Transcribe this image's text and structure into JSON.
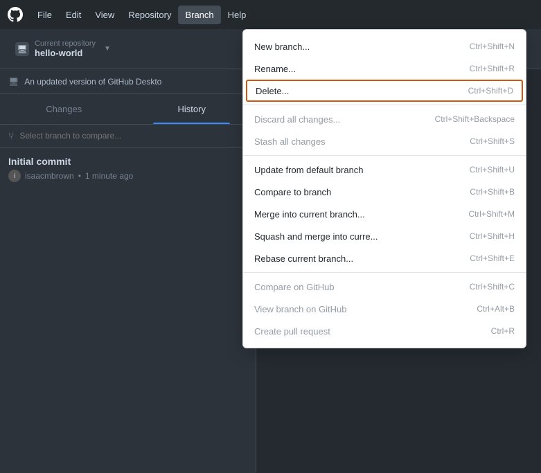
{
  "menubar": {
    "items": [
      {
        "label": "File",
        "active": false
      },
      {
        "label": "Edit",
        "active": false
      },
      {
        "label": "View",
        "active": false
      },
      {
        "label": "Repository",
        "active": false
      },
      {
        "label": "Branch",
        "active": true
      },
      {
        "label": "Help",
        "active": false
      }
    ]
  },
  "toolbar": {
    "repo_label": "Current repository",
    "repo_name": "hello-world"
  },
  "notification": {
    "text": "An updated version of GitHub Deskto"
  },
  "tabs": {
    "changes": "Changes",
    "history": "History"
  },
  "branch_compare": {
    "placeholder": "Select branch to compare..."
  },
  "commit": {
    "title": "Initial commit",
    "author": "isaacmbrown",
    "time": "1 minute ago"
  },
  "dropdown": {
    "sections": [
      {
        "items": [
          {
            "label": "New branch...",
            "shortcut": "Ctrl+Shift+N",
            "disabled": false,
            "highlighted": false
          },
          {
            "label": "Rename...",
            "shortcut": "Ctrl+Shift+R",
            "disabled": false,
            "highlighted": false
          },
          {
            "label": "Delete...",
            "shortcut": "Ctrl+Shift+D",
            "disabled": false,
            "highlighted": true
          }
        ]
      },
      {
        "items": [
          {
            "label": "Discard all changes...",
            "shortcut": "Ctrl+Shift+Backspace",
            "disabled": true,
            "highlighted": false
          },
          {
            "label": "Stash all changes",
            "shortcut": "Ctrl+Shift+S",
            "disabled": true,
            "highlighted": false
          }
        ]
      },
      {
        "items": [
          {
            "label": "Update from default branch",
            "shortcut": "Ctrl+Shift+U",
            "disabled": false,
            "highlighted": false
          },
          {
            "label": "Compare to branch",
            "shortcut": "Ctrl+Shift+B",
            "disabled": false,
            "highlighted": false
          },
          {
            "label": "Merge into current branch...",
            "shortcut": "Ctrl+Shift+M",
            "disabled": false,
            "highlighted": false
          },
          {
            "label": "Squash and merge into curre...",
            "shortcut": "Ctrl+Shift+H",
            "disabled": false,
            "highlighted": false
          },
          {
            "label": "Rebase current branch...",
            "shortcut": "Ctrl+Shift+E",
            "disabled": false,
            "highlighted": false
          }
        ]
      },
      {
        "items": [
          {
            "label": "Compare on GitHub",
            "shortcut": "Ctrl+Shift+C",
            "disabled": true,
            "highlighted": false
          },
          {
            "label": "View branch on GitHub",
            "shortcut": "Ctrl+Alt+B",
            "disabled": true,
            "highlighted": false
          },
          {
            "label": "Create pull request",
            "shortcut": "Ctrl+R",
            "disabled": true,
            "highlighted": false
          }
        ]
      }
    ]
  }
}
